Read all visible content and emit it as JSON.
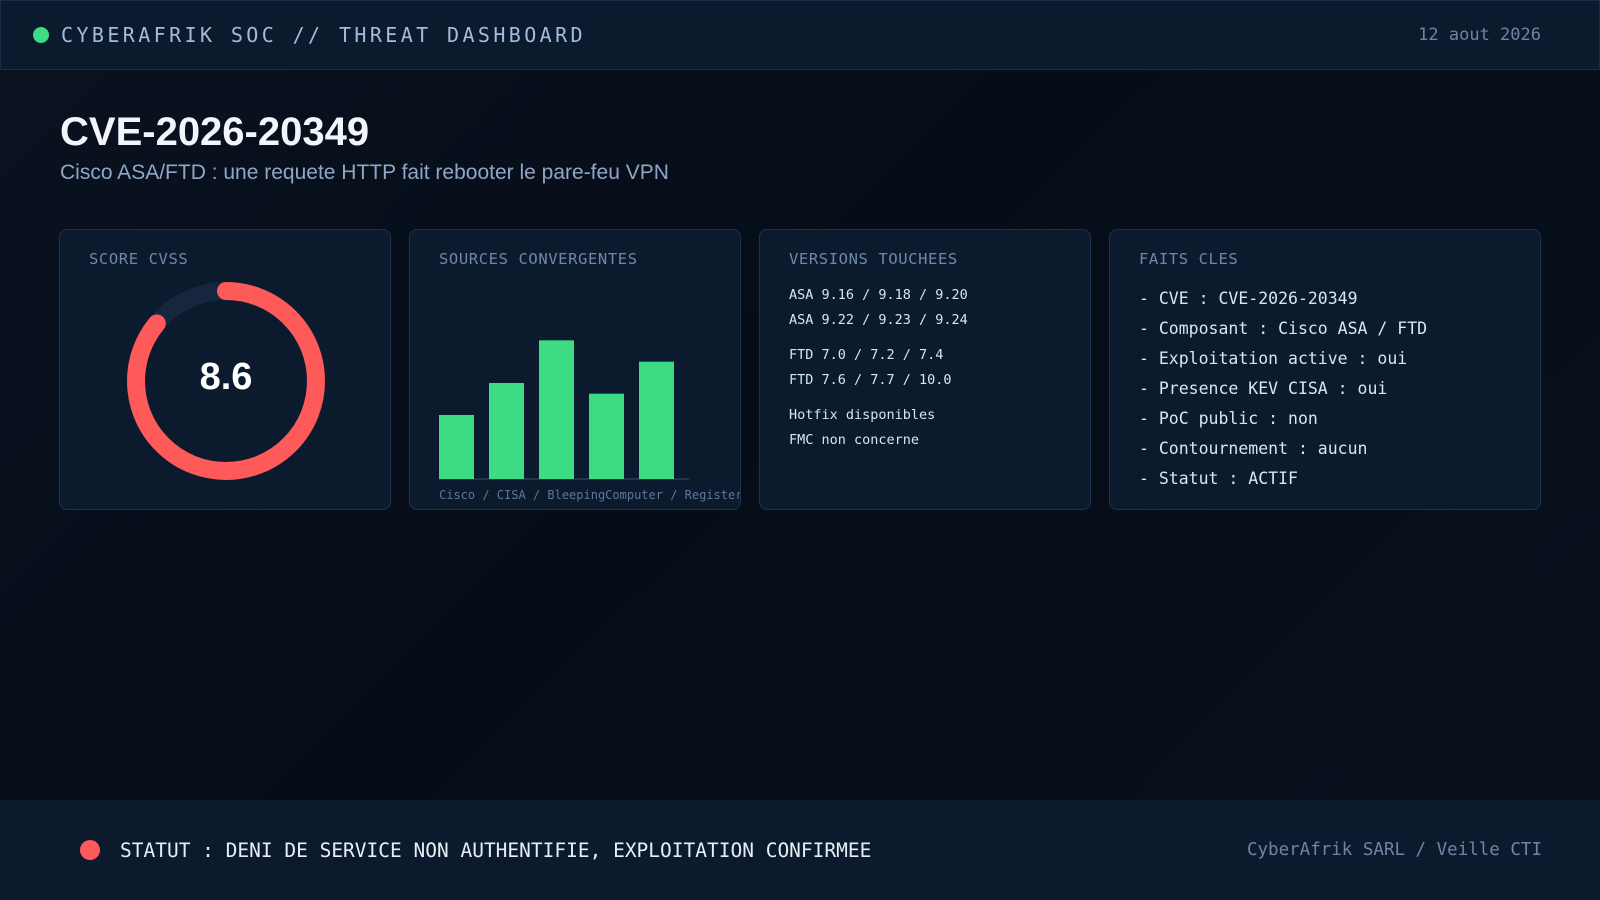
{
  "header": {
    "title": "CYBERAFRIK SOC // THREAT DASHBOARD",
    "date": "12 aout 2026",
    "status_color": "#3ddc84"
  },
  "hero": {
    "cve_id": "CVE-2026-20349",
    "subtitle": "Cisco ASA/FTD : une requete HTTP fait rebooter le pare-feu VPN"
  },
  "cards": {
    "cvss": {
      "label": "SCORE CVSS",
      "value": "8.6",
      "score": 8.6,
      "max": 10,
      "color": "#ff5a5a",
      "track_color": "#16263e"
    },
    "sources": {
      "label": "SOURCES CONVERGENTES",
      "caption": "Cisco / CISA / BleepingComputer / Register / U",
      "bar_color": "#3ddc84"
    },
    "versions": {
      "label": "VERSIONS TOUCHEES",
      "lines": [
        "ASA 9.16 / 9.18 / 9.20",
        "ASA 9.22 / 9.23 / 9.24",
        "FTD 7.0 / 7.2 / 7.4",
        "FTD 7.6 / 7.7 / 10.0",
        "Hotfix disponibles",
        "FMC non concerne"
      ]
    },
    "facts": {
      "label": "FAITS CLES",
      "lines": [
        "- CVE : CVE-2026-20349",
        "- Composant : Cisco ASA / FTD",
        "- Exploitation active : oui",
        "- Presence KEV CISA : oui",
        "- PoC public : non",
        "- Contournement : aucun",
        "- Statut : ACTIF"
      ]
    }
  },
  "chart_data": {
    "type": "bar",
    "values": [
      3,
      4.5,
      6.5,
      4,
      5.5
    ],
    "ylim": [
      0,
      7.5
    ],
    "title": "",
    "xlabel": "",
    "ylabel": ""
  },
  "footer": {
    "status": "STATUT : DENI DE SERVICE NON AUTHENTIFIE, EXPLOITATION CONFIRMEE",
    "status_color": "#ff5a5a",
    "credit": "CyberAfrik SARL / Veille CTI"
  }
}
